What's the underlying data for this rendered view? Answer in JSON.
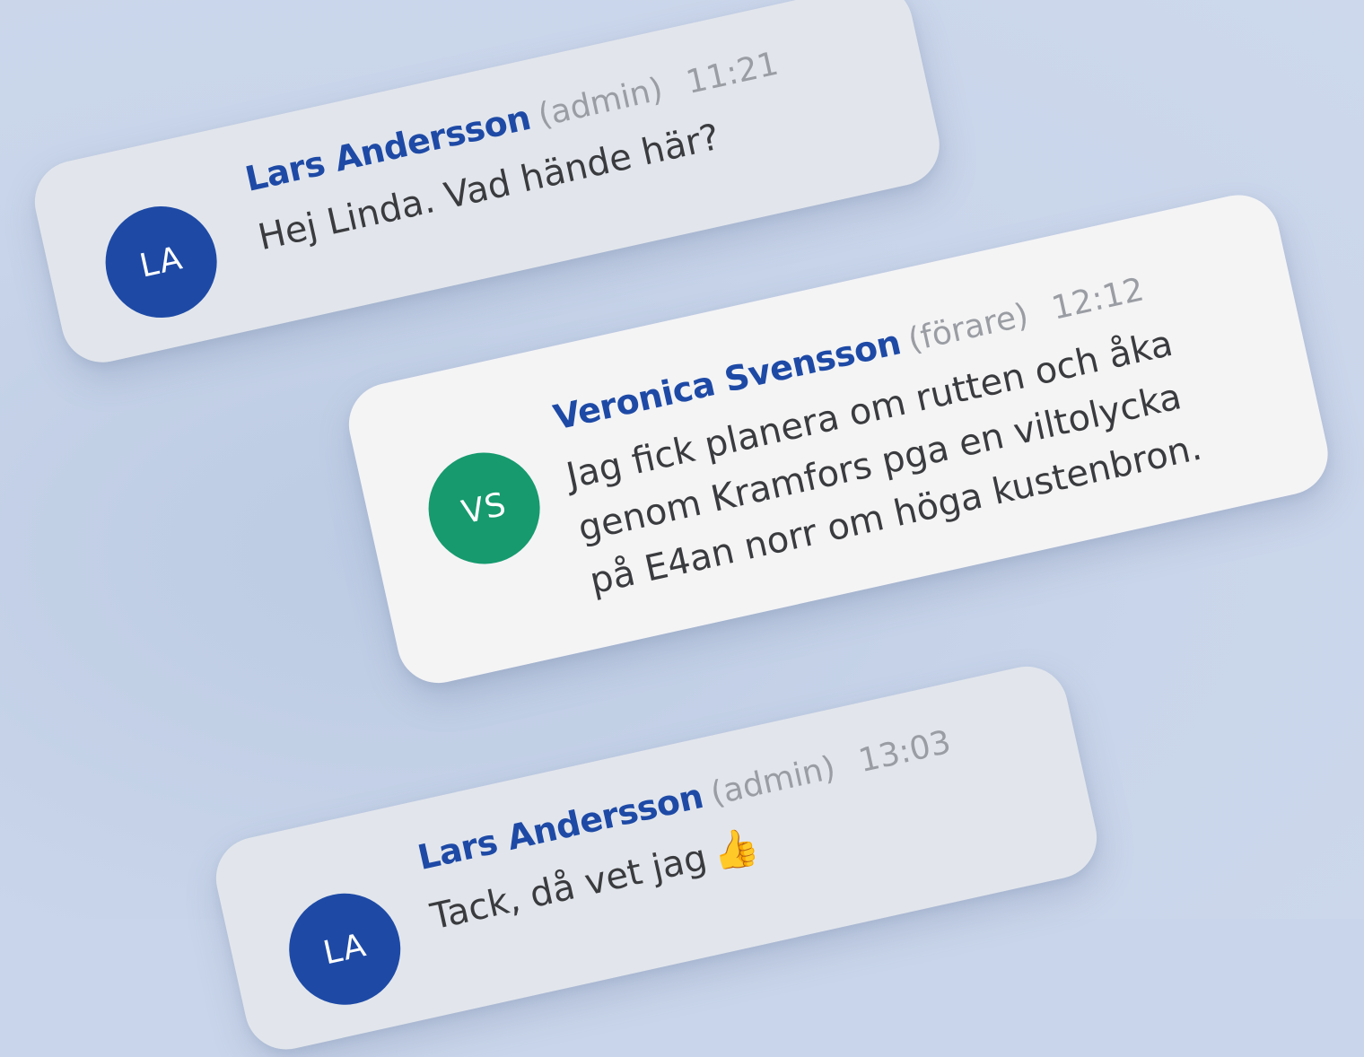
{
  "messages": [
    {
      "initials": "LA",
      "author": "Lars Andersson",
      "role": "(admin)",
      "time": "11:21",
      "lines": [
        "Hej Linda. Vad hände här?"
      ],
      "avatar_color": "#1e4aa6",
      "card_color": "#e2e6ec"
    },
    {
      "initials": "VS",
      "author": "Veronica Svensson",
      "role": "(förare)",
      "time": "12:12",
      "lines": [
        "Jag fick planera om rutten och åka",
        "genom Kramfors pga en viltolycka",
        "på E4an norr om höga kustenbron."
      ],
      "avatar_color": "#169a6e",
      "card_color": "#f4f4f5"
    },
    {
      "initials": "LA",
      "author": "Lars Andersson",
      "role": "(admin)",
      "time": "13:03",
      "lines": [
        "Tack, då vet jag"
      ],
      "emoji": "👍",
      "emoji_icon": "thumbs-up-icon",
      "avatar_color": "#1e4aa6",
      "card_color": "#e2e6ec"
    }
  ],
  "colors": {
    "background": "#c9d5ea",
    "author_name": "#1e4aa6",
    "meta_text": "#9a9da3",
    "message_text": "#3a3b3e"
  }
}
